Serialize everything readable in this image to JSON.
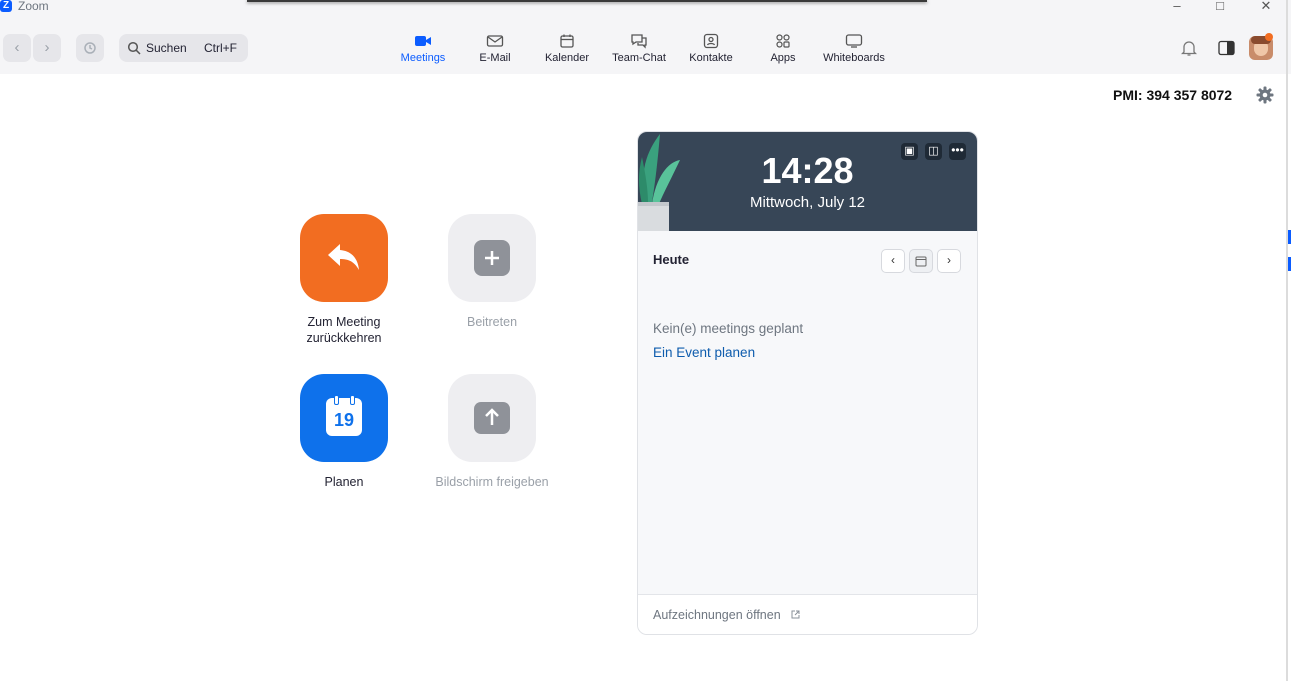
{
  "window": {
    "title": "Zoom",
    "logo_letter": "Z"
  },
  "search": {
    "label": "Suchen",
    "shortcut": "Ctrl+F"
  },
  "tabs": [
    {
      "label": "Meetings",
      "icon": "video-camera-icon",
      "active": true
    },
    {
      "label": "E-Mail",
      "icon": "envelope-icon"
    },
    {
      "label": "Kalender",
      "icon": "calendar-icon"
    },
    {
      "label": "Team-Chat",
      "icon": "chat-bubbles-icon"
    },
    {
      "label": "Kontakte",
      "icon": "contact-card-icon"
    },
    {
      "label": "Apps",
      "icon": "apps-grid-icon"
    },
    {
      "label": "Whiteboards",
      "icon": "whiteboard-icon"
    }
  ],
  "pmi": "PMI: 394 357 8072",
  "actions": {
    "return_label": "Zum Meeting\nzurückkehren",
    "join_label": "Beitreten",
    "schedule_label": "Planen",
    "schedule_day": "19",
    "share_label": "Bildschirm freigeben"
  },
  "calendar_card": {
    "time": "14:28",
    "date": "Mittwoch, July 12",
    "today": "Heute",
    "empty_text": "Kein(e) meetings geplant",
    "schedule_link": "Ein Event planen",
    "recordings_link": "Aufzeichnungen öffnen"
  },
  "colors": {
    "accent": "#0b5cff",
    "orange": "#f26d21",
    "blue_button": "#0e71eb",
    "card_header": "#374657",
    "link": "#0e5cad"
  }
}
